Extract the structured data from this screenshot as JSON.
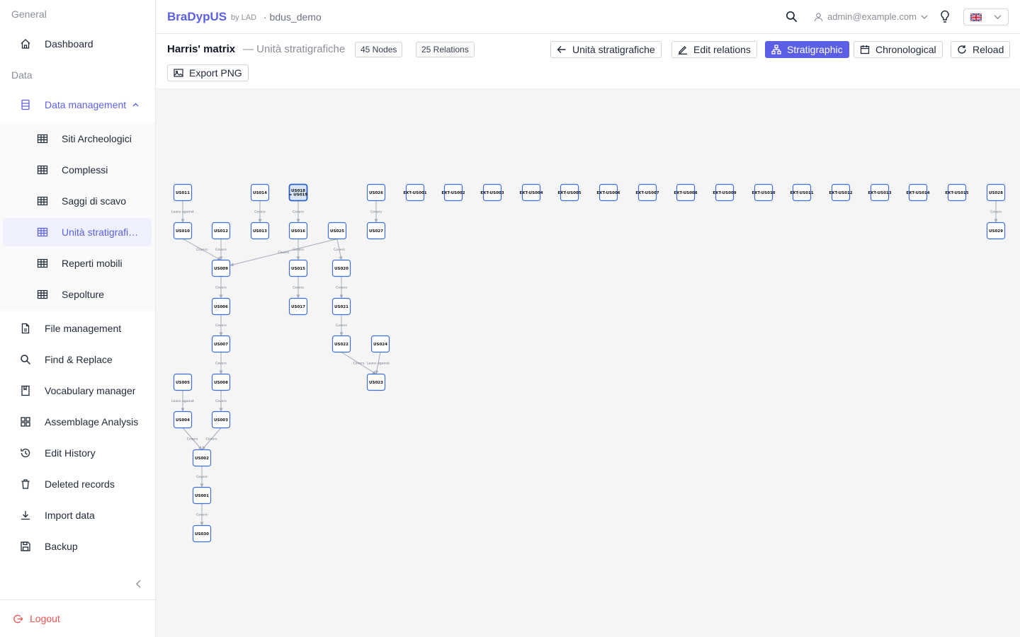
{
  "sidebar": {
    "section_general": "General",
    "section_data": "Data",
    "items": [
      {
        "label": "Dashboard",
        "icon": "home-icon"
      },
      {
        "label": "Data management",
        "icon": "database-icon"
      },
      {
        "label": "Siti Archeologici",
        "icon": "table-icon"
      },
      {
        "label": "Complessi",
        "icon": "table-icon"
      },
      {
        "label": "Saggi di scavo",
        "icon": "table-icon"
      },
      {
        "label": "Unità stratigrafiche",
        "icon": "table-icon"
      },
      {
        "label": "Reperti mobili",
        "icon": "table-icon"
      },
      {
        "label": "Sepolture",
        "icon": "table-icon"
      },
      {
        "label": "File management",
        "icon": "file-icon"
      },
      {
        "label": "Find & Replace",
        "icon": "search-icon"
      },
      {
        "label": "Vocabulary manager",
        "icon": "book-icon"
      },
      {
        "label": "Assemblage Analysis",
        "icon": "grid-icon"
      },
      {
        "label": "Edit History",
        "icon": "history-icon"
      },
      {
        "label": "Deleted records",
        "icon": "trash-icon"
      },
      {
        "label": "Import data",
        "icon": "download-icon"
      },
      {
        "label": "Backup",
        "icon": "save-icon"
      }
    ],
    "logout": "Logout"
  },
  "header": {
    "brand": "BraDypUS",
    "brand_by": "by LAD",
    "db": "· bdus_demo",
    "user": "admin@example.com"
  },
  "toolbar": {
    "title": "Harris' matrix",
    "subtitle": "— Unità stratigrafiche",
    "nodes_tag": "45 Nodes",
    "relations_tag": "25 Relations",
    "btn_back": "Unità stratigrafiche",
    "btn_edit": "Edit relations",
    "btn_strat": "Stratigraphic",
    "btn_chrono": "Chronological",
    "btn_reload": "Reload",
    "btn_export": "Export PNG"
  },
  "graph": {
    "nodes": [
      {
        "id": "US011"
      },
      {
        "id": "US014"
      },
      {
        "id": "US018 = US019"
      },
      {
        "id": "US026"
      },
      {
        "id": "EXT-US001"
      },
      {
        "id": "EXT-US002"
      },
      {
        "id": "EXT-US003"
      },
      {
        "id": "EXT-US004"
      },
      {
        "id": "EXT-US005"
      },
      {
        "id": "EXT-US006"
      },
      {
        "id": "EXT-US007"
      },
      {
        "id": "EXT-US008"
      },
      {
        "id": "EXT-US009"
      },
      {
        "id": "EXT-US010"
      },
      {
        "id": "EXT-US011"
      },
      {
        "id": "EXT-US012"
      },
      {
        "id": "EXT-US013"
      },
      {
        "id": "EXT-US014"
      },
      {
        "id": "EXT-US015"
      },
      {
        "id": "US028"
      },
      {
        "id": "US010"
      },
      {
        "id": "US012"
      },
      {
        "id": "US013"
      },
      {
        "id": "US016"
      },
      {
        "id": "US025"
      },
      {
        "id": "US027"
      },
      {
        "id": "US029"
      },
      {
        "id": "US009"
      },
      {
        "id": "US015"
      },
      {
        "id": "US020"
      },
      {
        "id": "US006"
      },
      {
        "id": "US017"
      },
      {
        "id": "US021"
      },
      {
        "id": "US007"
      },
      {
        "id": "US022"
      },
      {
        "id": "US024"
      },
      {
        "id": "US005"
      },
      {
        "id": "US008"
      },
      {
        "id": "US023"
      },
      {
        "id": "US004"
      },
      {
        "id": "US003"
      },
      {
        "id": "US002"
      },
      {
        "id": "US001"
      },
      {
        "id": "US030"
      }
    ],
    "edges": [
      {
        "from": "US011",
        "to": "US010",
        "label": "Leans against"
      },
      {
        "from": "US014",
        "to": "US013",
        "label": "Covers"
      },
      {
        "from": "US018 = US019",
        "to": "US016",
        "label": "Covers"
      },
      {
        "from": "US026",
        "to": "US027",
        "label": "Covers"
      },
      {
        "from": "US028",
        "to": "US029",
        "label": "Covers"
      },
      {
        "from": "US010",
        "to": "US009",
        "label": "Covers"
      },
      {
        "from": "US012",
        "to": "US009",
        "label": "Covers"
      },
      {
        "from": "US025",
        "to": "US009",
        "label": "Covers"
      },
      {
        "from": "US016",
        "to": "US015",
        "label": "Covers"
      },
      {
        "from": "US025",
        "to": "US020",
        "label": "Covers"
      },
      {
        "from": "US009",
        "to": "US006",
        "label": "Covers"
      },
      {
        "from": "US015",
        "to": "US017",
        "label": "Covers"
      },
      {
        "from": "US020",
        "to": "US021",
        "label": "Covers"
      },
      {
        "from": "US006",
        "to": "US007",
        "label": "Covers"
      },
      {
        "from": "US021",
        "to": "US022",
        "label": "Covers"
      },
      {
        "from": "US007",
        "to": "US008",
        "label": "Covers"
      },
      {
        "from": "US022",
        "to": "US023",
        "label": "Covers"
      },
      {
        "from": "US024",
        "to": "US023",
        "label": "Leans against"
      },
      {
        "from": "US005",
        "to": "US004",
        "label": "Leans against"
      },
      {
        "from": "US008",
        "to": "US003",
        "label": "Covers"
      },
      {
        "from": "US004",
        "to": "US002",
        "label": "Covers"
      },
      {
        "from": "US003",
        "to": "US002",
        "label": "Covers"
      },
      {
        "from": "US002",
        "to": "US001",
        "label": "Covers"
      },
      {
        "from": "US001",
        "to": "US030",
        "label": "Covers"
      }
    ]
  },
  "colors": {
    "accent": "#5b5fe6",
    "node_border": "#3b6fd8",
    "logout": "#ef5350"
  }
}
